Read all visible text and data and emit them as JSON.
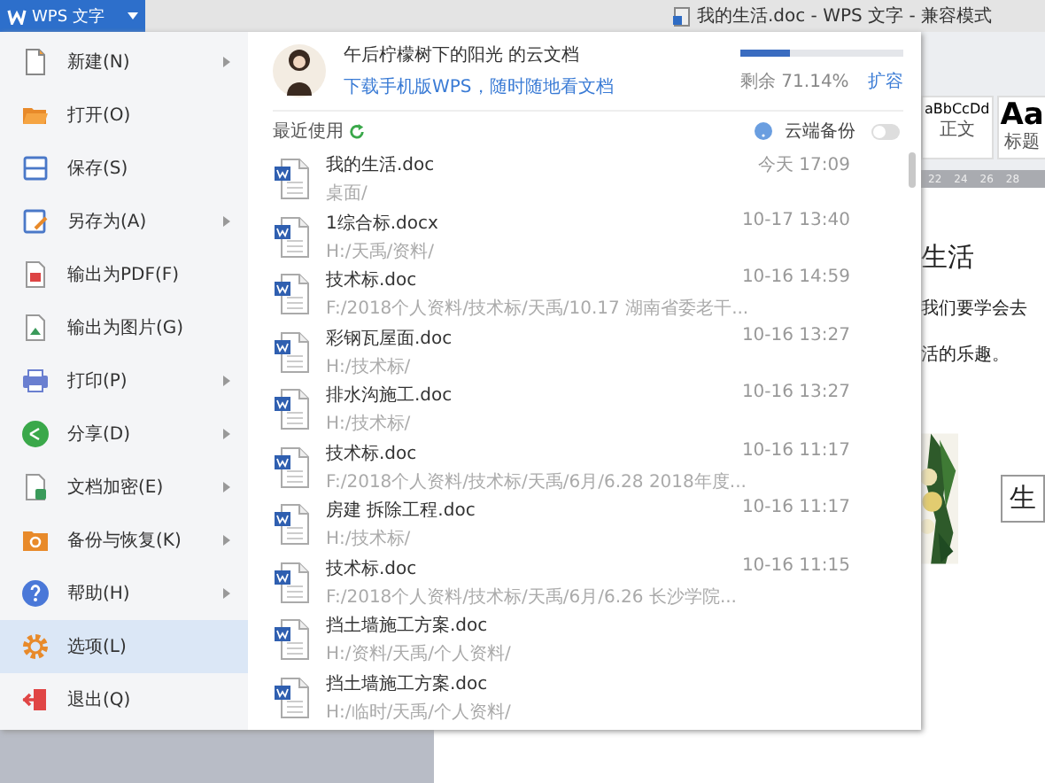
{
  "app_menu_button": {
    "label": "WPS 文字"
  },
  "window": {
    "title": "我的生活.doc - WPS 文字 - 兼容模式"
  },
  "menu": [
    {
      "label": "新建(N)",
      "submenu": true,
      "selected": false
    },
    {
      "label": "打开(O)",
      "submenu": false,
      "selected": false
    },
    {
      "label": "保存(S)",
      "submenu": false,
      "selected": false
    },
    {
      "label": "另存为(A)",
      "submenu": true,
      "selected": false
    },
    {
      "label": "输出为PDF(F)",
      "submenu": false,
      "selected": false
    },
    {
      "label": "输出为图片(G)",
      "submenu": false,
      "selected": false
    },
    {
      "label": "打印(P)",
      "submenu": true,
      "selected": false
    },
    {
      "label": "分享(D)",
      "submenu": true,
      "selected": false
    },
    {
      "label": "文档加密(E)",
      "submenu": true,
      "selected": false
    },
    {
      "label": "备份与恢复(K)",
      "submenu": true,
      "selected": false
    },
    {
      "label": "帮助(H)",
      "submenu": true,
      "selected": false
    },
    {
      "label": "选项(L)",
      "submenu": false,
      "selected": true
    },
    {
      "label": "退出(Q)",
      "submenu": false,
      "selected": false
    }
  ],
  "cloud": {
    "owner": "午后柠檬树下的阳光 的云文档",
    "download_link": "下载手机版WPS，随时随地看文档",
    "storage": {
      "level": 0.3,
      "reading": "剩余 71.14%",
      "expand_link": "扩容"
    }
  },
  "recent": {
    "title": "最近使用",
    "backup_label": "云端备份",
    "backup_on": false
  },
  "files": [
    {
      "name": "我的生活.doc",
      "path": "桌面/",
      "time": "今天 17:09"
    },
    {
      "name": "1综合标.docx",
      "path": "H:/天禹/资料/",
      "time": "10-17 13:40"
    },
    {
      "name": "技术标.doc",
      "path": "F:/2018个人资料/技术标/天禹/10.17  湖南省委老干...",
      "time": "10-16 14:59"
    },
    {
      "name": "彩钢瓦屋面.doc",
      "path": "H:/技术标/",
      "time": "10-16 13:27"
    },
    {
      "name": "排水沟施工.doc",
      "path": "H:/技术标/",
      "time": "10-16 13:27"
    },
    {
      "name": "技术标.doc",
      "path": "F:/2018个人资料/技术标/天禹/6月/6.28  2018年度...",
      "time": "10-16 11:17"
    },
    {
      "name": "房建 拆除工程.doc",
      "path": "H:/技术标/",
      "time": "10-16 11:17"
    },
    {
      "name": "技术标.doc",
      "path": "F:/2018个人资料/技术标/天禹/6月/6.26  长沙学院...",
      "time": "10-16 11:15"
    },
    {
      "name": "挡土墙施工方案.doc",
      "path": "H:/资料/天禹/个人资料/"
    },
    {
      "name": "挡土墙施工方案.doc",
      "path": "H:/临时/天禹/个人资料/"
    }
  ],
  "document": {
    "styles": [
      {
        "sample": "aBbCcDd",
        "name": "正文"
      },
      {
        "sample": "Aa",
        "name": "标题"
      }
    ],
    "ruler": [
      "22",
      "24",
      "26",
      "28"
    ],
    "heading": "生活",
    "paragraphs": [
      "我们要学会去",
      "活的乐趣。"
    ],
    "box_text": "生"
  }
}
